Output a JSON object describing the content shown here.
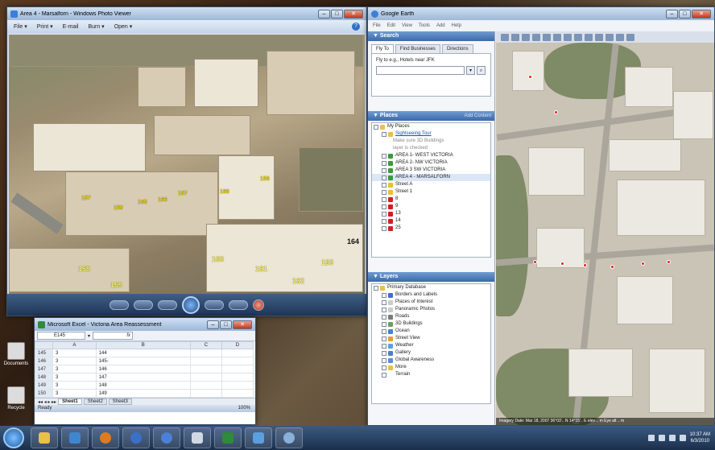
{
  "photo_viewer": {
    "title": "Area 4 - Marsalforn - Windows Photo Viewer",
    "menu": [
      "File ▾",
      "Print ▾",
      "E-mail",
      "Burn ▾",
      "Open ▾"
    ],
    "labels": [
      "156",
      "157",
      "159",
      "165",
      "166",
      "167",
      "168",
      "160",
      "161",
      "162",
      "163",
      "164",
      "158",
      "159"
    ]
  },
  "earth": {
    "title": "Google Earth",
    "menu": [
      "File",
      "Edit",
      "View",
      "Tools",
      "Add",
      "Help"
    ],
    "search": {
      "header": "Search",
      "tabs": [
        "Fly To",
        "Find Businesses",
        "Directions"
      ],
      "hint": "Fly to e.g., Hotels near JFK"
    },
    "places": {
      "header": "Places",
      "add_content": "Add Content",
      "items": [
        {
          "label": "My Places",
          "type": "folder",
          "color": "#e8c04a"
        },
        {
          "label": "Sightseeing Tour",
          "type": "link",
          "color": "#e8c04a"
        },
        {
          "label": "Make sure 3D Buildings",
          "type": "note",
          "color": "#ffffff"
        },
        {
          "label": "layer is checked",
          "type": "note",
          "color": "#ffffff"
        },
        {
          "label": "AREA 1- WEST VICTORIA",
          "type": "item",
          "color": "#3b9b3b"
        },
        {
          "label": "AREA 2- NW VICTORIA",
          "type": "item",
          "color": "#3b9b3b"
        },
        {
          "label": "AREA 3 SW VICTORIA",
          "type": "item",
          "color": "#3b9b3b"
        },
        {
          "label": "AREA 4 - MARSALFORN",
          "type": "selected",
          "color": "#3b9b3b"
        },
        {
          "label": "Street A",
          "type": "item",
          "color": "#e8c030"
        },
        {
          "label": "Street 1",
          "type": "item",
          "color": "#e8c030"
        },
        {
          "label": "8",
          "type": "item",
          "color": "#d02020"
        },
        {
          "label": "9",
          "type": "item",
          "color": "#d02020"
        },
        {
          "label": "13",
          "type": "item",
          "color": "#d02020"
        },
        {
          "label": "14",
          "type": "item",
          "color": "#d02020"
        },
        {
          "label": "25",
          "type": "item",
          "color": "#d02020"
        }
      ]
    },
    "layers": {
      "header": "Layers",
      "items": [
        {
          "label": "Primary Database",
          "color": "#e8c04a"
        },
        {
          "label": "Borders and Labels",
          "color": "#3f6fd0"
        },
        {
          "label": "Places of Interest",
          "color": "#cccccc"
        },
        {
          "label": "Panoramic Photos",
          "color": "#cccccc"
        },
        {
          "label": "Roads",
          "color": "#7a7a7a"
        },
        {
          "label": "3D Buildings",
          "color": "#6aa060"
        },
        {
          "label": "Ocean",
          "color": "#3f86d0"
        },
        {
          "label": "Street View",
          "color": "#e8a030"
        },
        {
          "label": "Weather",
          "color": "#5aa0e0"
        },
        {
          "label": "Gallery",
          "color": "#4f7fc0"
        },
        {
          "label": "Global Awareness",
          "color": "#5a8fd0"
        },
        {
          "label": "More",
          "color": "#e8c04a"
        },
        {
          "label": "Terrain",
          "color": "#ffffff"
        }
      ]
    },
    "status": "Imagery Date: Mar 18, 2007  36°03'.. N 14°15'.. E  elev .. m  Eye alt .. m"
  },
  "excel": {
    "title": "Microsoft Excel - Victoria Area Reassessment",
    "cell_ref": "E145",
    "fx": "fx",
    "columns": [
      "",
      "A",
      "B",
      "C",
      "D"
    ],
    "rows": [
      {
        "n": "145",
        "a": "3",
        "b": "144"
      },
      {
        "n": "146",
        "a": "3",
        "b": "145-"
      },
      {
        "n": "147",
        "a": "3",
        "b": "146"
      },
      {
        "n": "148",
        "a": "3",
        "b": "147"
      },
      {
        "n": "149",
        "a": "3",
        "b": "148"
      },
      {
        "n": "150",
        "a": "3",
        "b": "149"
      }
    ],
    "sheets": [
      "Sheet1",
      "Sheet2",
      "Sheet3"
    ],
    "status": "Ready",
    "zoom": "100%"
  },
  "desktop_icons": [
    "Documents",
    "Recycle"
  ],
  "taskbar": {
    "time": "10:37 AM",
    "date": "6/3/2010"
  },
  "colors": {
    "taskbar": "#1b2f4c",
    "title_bar": "#9db7d6",
    "label_yellow": "#f4e100"
  }
}
